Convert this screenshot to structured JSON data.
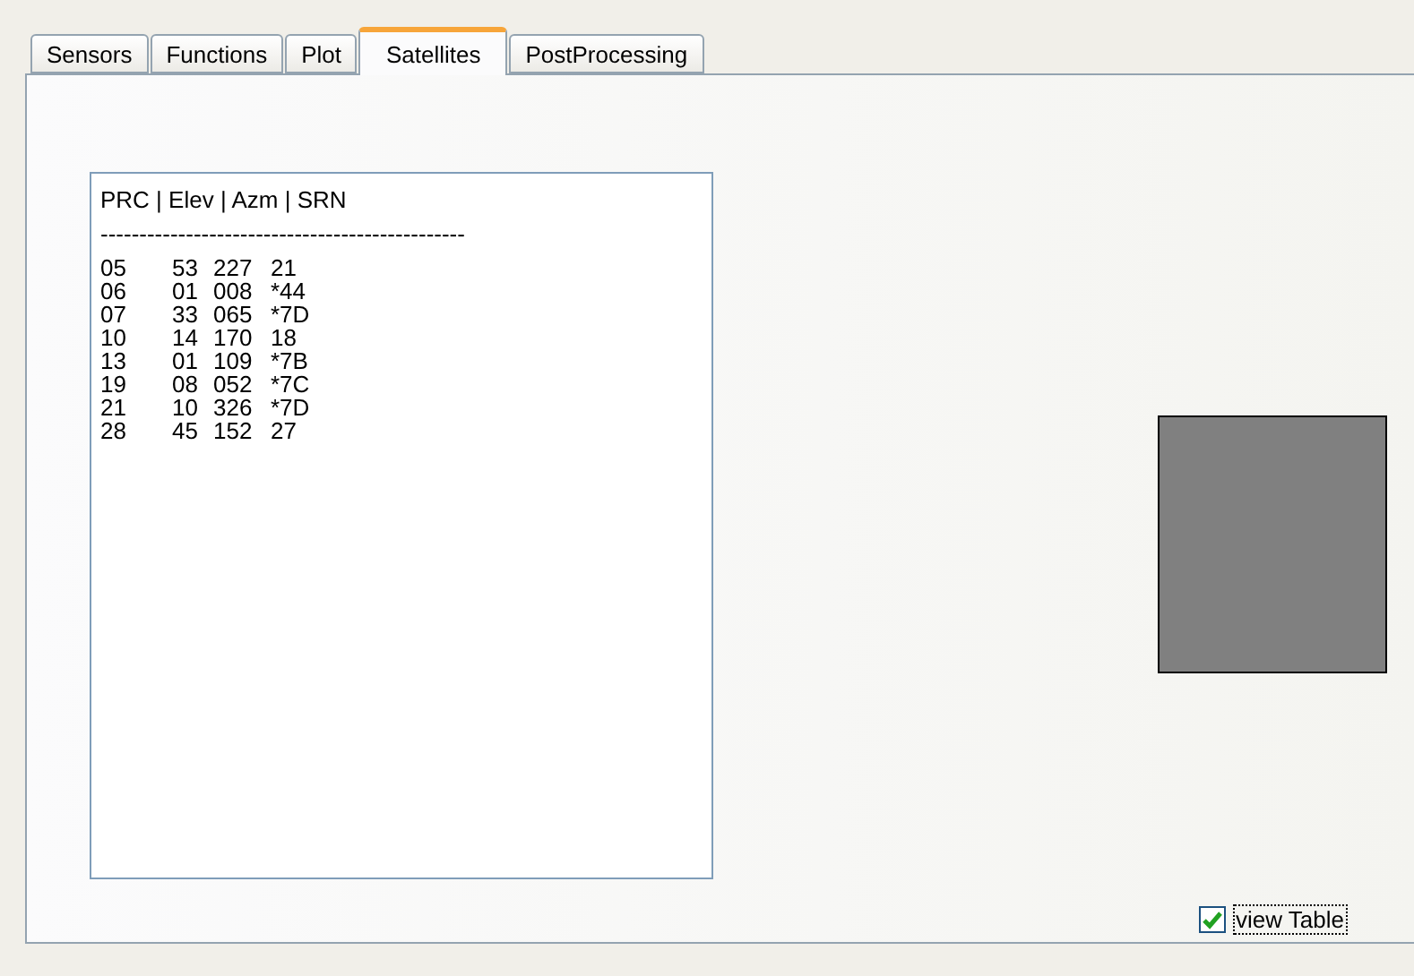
{
  "tabs": [
    {
      "label": "Sensors",
      "selected": false
    },
    {
      "label": "Functions",
      "selected": false
    },
    {
      "label": "Plot",
      "selected": false
    },
    {
      "label": "Satellites",
      "selected": true
    },
    {
      "label": "PostProcessing",
      "selected": false
    }
  ],
  "satellite_list": {
    "header": "PRC | Elev | Azm | SRN",
    "separator": "-----------------------------------------------",
    "rows": [
      [
        "05",
        "53",
        "227",
        "21"
      ],
      [
        "06",
        "01",
        "008",
        "*44"
      ],
      [
        "07",
        "33",
        "065",
        "*7D"
      ],
      [
        "10",
        "14",
        "170",
        "18"
      ],
      [
        "13",
        "01",
        "109",
        "*7B"
      ],
      [
        "19",
        "08",
        "052",
        "*7C"
      ],
      [
        "21",
        "10",
        "326",
        "*7D"
      ],
      [
        "28",
        "45",
        "152",
        "27"
      ]
    ]
  },
  "view_table": {
    "label": "view Table",
    "checked": true
  }
}
